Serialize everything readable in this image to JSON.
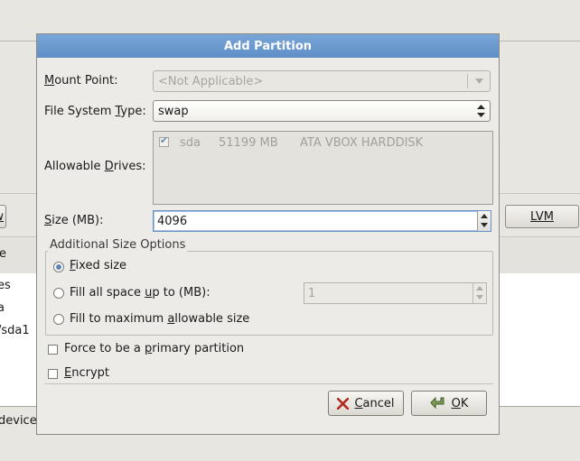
{
  "background": {
    "left_button_fragment": "w",
    "lvm_button": "LVM",
    "header_fragment": "e",
    "list_rows": [
      "es",
      "a",
      "/sda1"
    ],
    "status_fragment": "device"
  },
  "dialog": {
    "title": "Add Partition",
    "mount_point": {
      "label_pre": "",
      "label_u": "M",
      "label_post": "ount Point:",
      "value": "<Not Applicable>"
    },
    "fs_type": {
      "label_pre": "File System ",
      "label_u": "T",
      "label_post": "ype:",
      "value": "swap"
    },
    "drives": {
      "label_pre": "Allowable ",
      "label_u": "D",
      "label_post": "rives:",
      "rows": [
        {
          "name": "sda",
          "size": "51199 MB",
          "model": "ATA VBOX HARDDISK",
          "checked": true
        }
      ]
    },
    "size": {
      "label_pre": "",
      "label_u": "S",
      "label_post": "ize (MB):",
      "value": "4096"
    },
    "additional": {
      "title": "Additional Size Options",
      "fixed": {
        "pre": "",
        "u": "F",
        "post": "ixed size",
        "selected": true
      },
      "fill_upto": {
        "pre": "Fill all space ",
        "u": "u",
        "post": "p to (MB):",
        "value": "1",
        "selected": false
      },
      "fill_max": {
        "pre": "Fill to maximum ",
        "u": "a",
        "post": "llowable size",
        "selected": false
      }
    },
    "force_primary": {
      "pre": "Force to be a ",
      "u": "p",
      "post": "rimary partition",
      "checked": false
    },
    "encrypt": {
      "pre": "",
      "u": "E",
      "post": "ncrypt",
      "checked": false
    },
    "buttons": {
      "cancel": {
        "pre": "",
        "u": "C",
        "post": "ancel"
      },
      "ok": {
        "pre": "",
        "u": "O",
        "post": "K"
      }
    }
  }
}
